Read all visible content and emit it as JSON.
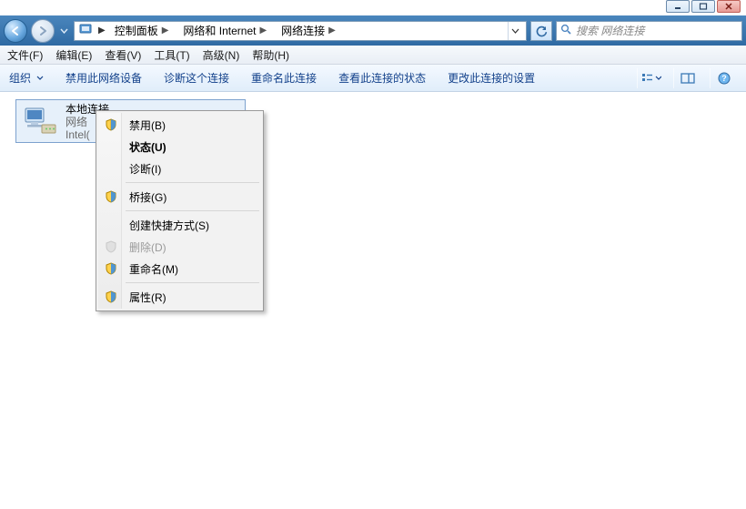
{
  "window_controls": {
    "minimize": "minimize",
    "maximize": "maximize",
    "close": "close"
  },
  "breadcrumb": {
    "icon": "control-panel",
    "items": [
      "控制面板",
      "网络和 Internet",
      "网络连接"
    ]
  },
  "search": {
    "placeholder": "搜索 网络连接"
  },
  "menubar": {
    "file": "文件(F)",
    "edit": "编辑(E)",
    "view": "查看(V)",
    "tools": "工具(T)",
    "adv": "高级(N)",
    "help": "帮助(H)"
  },
  "toolbar": {
    "organize": "组织",
    "disable": "禁用此网络设备",
    "diagnose": "诊断这个连接",
    "rename": "重命名此连接",
    "status": "查看此连接的状态",
    "changeset": "更改此连接的设置"
  },
  "connection": {
    "name": "本地连接",
    "status": "网络",
    "device": "Intel("
  },
  "context_menu": {
    "disable": "禁用(B)",
    "status": "状态(U)",
    "diagnose": "诊断(I)",
    "bridge": "桥接(G)",
    "shortcut": "创建快捷方式(S)",
    "delete": "删除(D)",
    "rename": "重命名(M)",
    "props": "属性(R)"
  }
}
